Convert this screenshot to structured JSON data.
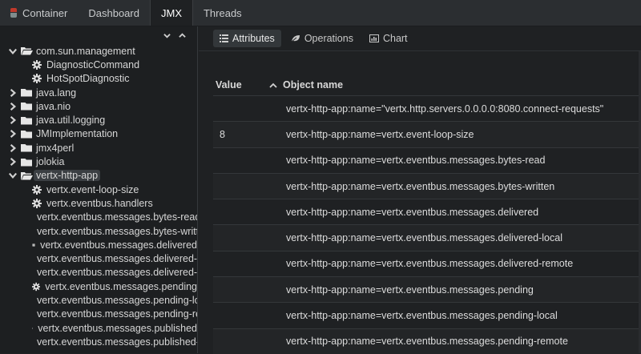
{
  "nav": {
    "tabs": [
      {
        "label": "Container",
        "active": false
      },
      {
        "label": "Dashboard",
        "active": false
      },
      {
        "label": "JMX",
        "active": true
      },
      {
        "label": "Threads",
        "active": false
      }
    ]
  },
  "sidebar": {
    "tree": [
      {
        "label": "com.sun.management",
        "type": "folder",
        "expanded": true,
        "depth": 0
      },
      {
        "label": "DiagnosticCommand",
        "type": "mbean",
        "depth": 1
      },
      {
        "label": "HotSpotDiagnostic",
        "type": "mbean",
        "depth": 1
      },
      {
        "label": "java.lang",
        "type": "folder",
        "expanded": false,
        "depth": 0
      },
      {
        "label": "java.nio",
        "type": "folder",
        "expanded": false,
        "depth": 0
      },
      {
        "label": "java.util.logging",
        "type": "folder",
        "expanded": false,
        "depth": 0
      },
      {
        "label": "JMImplementation",
        "type": "folder",
        "expanded": false,
        "depth": 0
      },
      {
        "label": "jmx4perl",
        "type": "folder",
        "expanded": false,
        "depth": 0
      },
      {
        "label": "jolokia",
        "type": "folder",
        "expanded": false,
        "depth": 0
      },
      {
        "label": "vertx-http-app",
        "type": "folder",
        "expanded": true,
        "depth": 0,
        "selected": true
      },
      {
        "label": "vertx.event-loop-size",
        "type": "mbean",
        "depth": 1
      },
      {
        "label": "vertx.eventbus.handlers",
        "type": "mbean",
        "depth": 1
      },
      {
        "label": "vertx.eventbus.messages.bytes-read",
        "type": "mbean",
        "depth": 1
      },
      {
        "label": "vertx.eventbus.messages.bytes-written",
        "type": "mbean",
        "depth": 1
      },
      {
        "label": "vertx.eventbus.messages.delivered",
        "type": "mbean",
        "depth": 1
      },
      {
        "label": "vertx.eventbus.messages.delivered-local",
        "type": "mbean",
        "depth": 1
      },
      {
        "label": "vertx.eventbus.messages.delivered-remote",
        "type": "mbean",
        "depth": 1
      },
      {
        "label": "vertx.eventbus.messages.pending",
        "type": "mbean",
        "depth": 1
      },
      {
        "label": "vertx.eventbus.messages.pending-local",
        "type": "mbean",
        "depth": 1
      },
      {
        "label": "vertx.eventbus.messages.pending-remote",
        "type": "mbean",
        "depth": 1
      },
      {
        "label": "vertx.eventbus.messages.published",
        "type": "mbean",
        "depth": 1
      },
      {
        "label": "vertx.eventbus.messages.published-local",
        "type": "mbean",
        "depth": 1
      }
    ]
  },
  "subtabs": [
    {
      "label": "Attributes",
      "icon": "list-icon",
      "active": true
    },
    {
      "label": "Operations",
      "icon": "leaf-icon",
      "active": false
    },
    {
      "label": "Chart",
      "icon": "bar-chart-icon",
      "active": false
    }
  ],
  "table": {
    "col_value": "Value",
    "col_name": "Object name",
    "rows": [
      {
        "value": "",
        "name": "vertx-http-app:name=\"vertx.http.servers.0.0.0.0:8080.connect-requests\""
      },
      {
        "value": "8",
        "name": "vertx-http-app:name=vertx.event-loop-size"
      },
      {
        "value": "",
        "name": "vertx-http-app:name=vertx.eventbus.messages.bytes-read"
      },
      {
        "value": "",
        "name": "vertx-http-app:name=vertx.eventbus.messages.bytes-written"
      },
      {
        "value": "",
        "name": "vertx-http-app:name=vertx.eventbus.messages.delivered"
      },
      {
        "value": "",
        "name": "vertx-http-app:name=vertx.eventbus.messages.delivered-local"
      },
      {
        "value": "",
        "name": "vertx-http-app:name=vertx.eventbus.messages.delivered-remote"
      },
      {
        "value": "",
        "name": "vertx-http-app:name=vertx.eventbus.messages.pending"
      },
      {
        "value": "",
        "name": "vertx-http-app:name=vertx.eventbus.messages.pending-local"
      },
      {
        "value": "",
        "name": "vertx-http-app:name=vertx.eventbus.messages.pending-remote"
      }
    ]
  }
}
